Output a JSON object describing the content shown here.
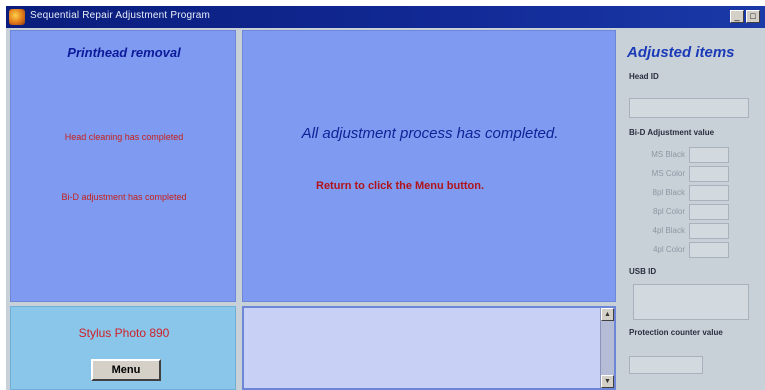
{
  "window": {
    "title": "Sequential Repair Adjustment Program",
    "controls": [
      "_",
      "□"
    ]
  },
  "left_panel": {
    "title": "Printhead removal",
    "status_lines": [
      "Head cleaning has completed",
      "Bi-D adjustment has completed"
    ]
  },
  "center_panel": {
    "completed_message": "All adjustment process has completed.",
    "return_message": "Return to click the Menu button."
  },
  "bottom_left": {
    "model": "Stylus Photo 890",
    "menu_label": "Menu"
  },
  "log_area": {
    "text": ""
  },
  "right_panel": {
    "title": "Adjusted items",
    "head_id_label": "Head ID",
    "head_id_value": "",
    "bid_label": "Bi-D Adjustment value",
    "bid_items": [
      {
        "label": "MS Black",
        "value": ""
      },
      {
        "label": "MS Color",
        "value": ""
      },
      {
        "label": "8pl Black",
        "value": ""
      },
      {
        "label": "8pl Color",
        "value": ""
      },
      {
        "label": "4pl Black",
        "value": ""
      },
      {
        "label": "4pl Color",
        "value": ""
      }
    ],
    "usb_id_label": "USB ID",
    "usb_id_value": "",
    "protection_label": "Protection counter value",
    "protection_value": ""
  }
}
